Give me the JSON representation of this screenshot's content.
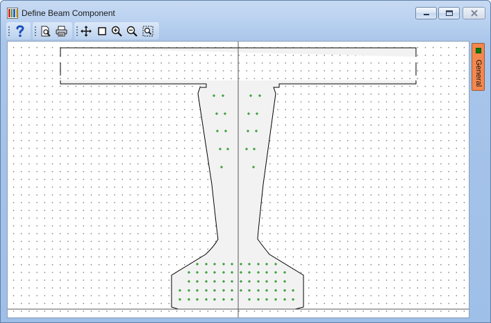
{
  "window": {
    "title": "Define Beam Component",
    "controls": {
      "minimize": "minimize-icon",
      "maximize": "maximize-icon",
      "close": "close-icon"
    }
  },
  "toolbar": {
    "groups": [
      {
        "buttons": [
          {
            "name": "help-button",
            "icon": "help-icon"
          }
        ]
      },
      {
        "buttons": [
          {
            "name": "print-preview-button",
            "icon": "print-preview-icon"
          },
          {
            "name": "print-button",
            "icon": "printer-icon"
          }
        ]
      },
      {
        "buttons": [
          {
            "name": "pan-button",
            "icon": "pan-icon"
          },
          {
            "name": "select-box-button",
            "icon": "rectangle-icon"
          },
          {
            "name": "zoom-in-button",
            "icon": "zoom-in-icon"
          },
          {
            "name": "zoom-out-button",
            "icon": "zoom-out-icon"
          },
          {
            "name": "zoom-extents-button",
            "icon": "zoom-extents-icon"
          }
        ]
      }
    ]
  },
  "side_panel": {
    "tab_label": "General"
  },
  "drawing": {
    "shape": "bulb-tee-girder-section",
    "colors": {
      "section_fill": "#f2f2f2",
      "outline": "#000000",
      "strand": "#0a8a0a",
      "axis": "#555555"
    },
    "strand_count": 63
  }
}
